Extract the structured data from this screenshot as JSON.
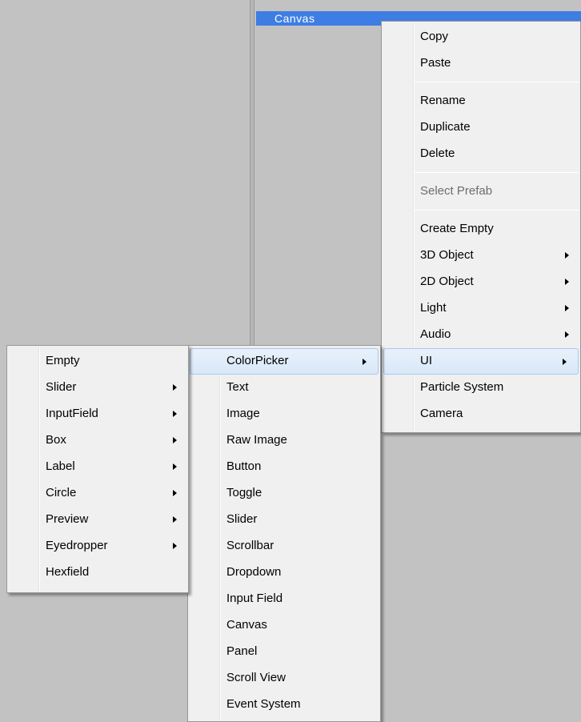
{
  "hierarchy": {
    "selected_item": "Canvas"
  },
  "context_menu": {
    "items": [
      {
        "label": "Copy"
      },
      {
        "label": "Paste"
      },
      {
        "label": "Rename"
      },
      {
        "label": "Duplicate"
      },
      {
        "label": "Delete"
      },
      {
        "label": "Select Prefab",
        "disabled": true
      },
      {
        "label": "Create Empty"
      },
      {
        "label": "3D Object",
        "submenu": true
      },
      {
        "label": "2D Object",
        "submenu": true
      },
      {
        "label": "Light",
        "submenu": true
      },
      {
        "label": "Audio",
        "submenu": true
      },
      {
        "label": "UI",
        "submenu": true,
        "highlighted": true
      },
      {
        "label": "Particle System"
      },
      {
        "label": "Camera"
      }
    ]
  },
  "ui_submenu": {
    "items": [
      {
        "label": "ColorPicker",
        "submenu": true,
        "highlighted": true
      },
      {
        "label": "Text"
      },
      {
        "label": "Image"
      },
      {
        "label": "Raw Image"
      },
      {
        "label": "Button"
      },
      {
        "label": "Toggle"
      },
      {
        "label": "Slider"
      },
      {
        "label": "Scrollbar"
      },
      {
        "label": "Dropdown"
      },
      {
        "label": "Input Field"
      },
      {
        "label": "Canvas"
      },
      {
        "label": "Panel"
      },
      {
        "label": "Scroll View"
      },
      {
        "label": "Event System"
      }
    ]
  },
  "colorpicker_submenu": {
    "items": [
      {
        "label": "Empty"
      },
      {
        "label": "Slider",
        "submenu": true
      },
      {
        "label": "InputField",
        "submenu": true
      },
      {
        "label": "Box",
        "submenu": true
      },
      {
        "label": "Label",
        "submenu": true
      },
      {
        "label": "Circle",
        "submenu": true
      },
      {
        "label": "Preview",
        "submenu": true
      },
      {
        "label": "Eyedropper",
        "submenu": true
      },
      {
        "label": "Hexfield"
      }
    ]
  },
  "icons": {
    "submenu_arrow": "chevron-right-icon"
  },
  "colors": {
    "selection_blue": "#3d7de4",
    "menu_background": "#f0f0f0",
    "panel_background": "#c2c2c2",
    "highlight_border": "#a9c8ed"
  }
}
